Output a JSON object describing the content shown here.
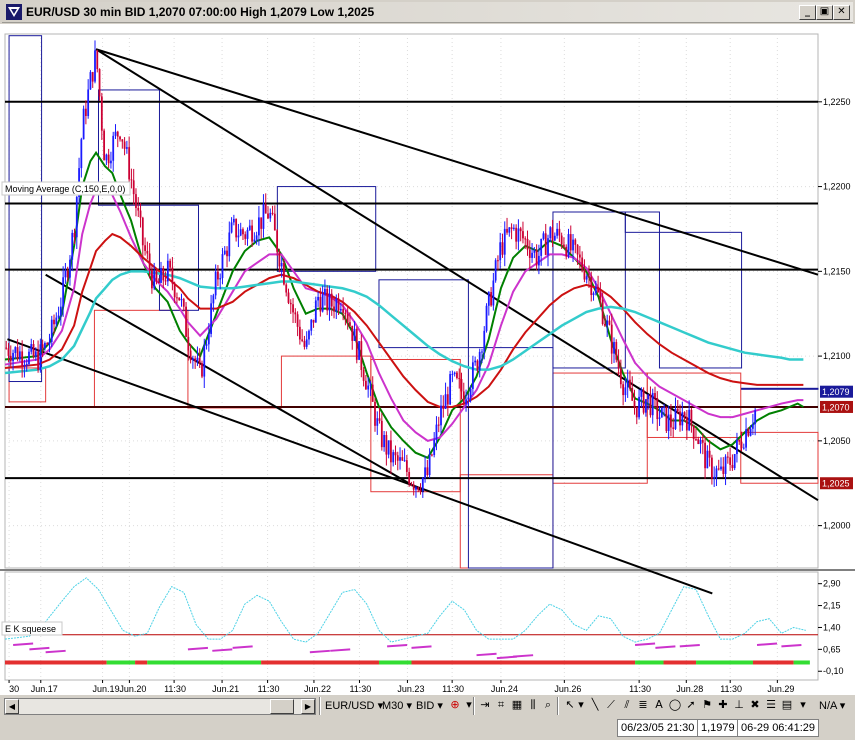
{
  "window": {
    "title": "EUR/USD 30 min BID 1,2070 07:00:00 High 1,2079 Low 1,2025",
    "min_glyph": "_",
    "max_glyph": "▣",
    "close_glyph": "✕"
  },
  "colors": {
    "candle_up": "#1a1aff",
    "candle_down": "#cc0033",
    "ma_fast": "#008000",
    "ma_mid": "#cc33cc",
    "ma_red": "#cc1111",
    "ma_cyan": "#33cccc",
    "box_blue": "#1a1a9a",
    "box_red": "#e33a3a",
    "squeeze_line": "#4dd2e6",
    "squeeze_hist": "#cc33cc",
    "squeeze_on": "#e33030",
    "squeeze_off": "#33dd33"
  },
  "chart_data": [
    {
      "type": "candlestick",
      "title": "EUR/USD 30 min BID 1,2070 07:00:00 High 1,2079 Low 1,2025",
      "indicator_label": "Moving Average (C,150,E,0,0)",
      "ylim": [
        1.1975,
        1.229
      ],
      "y_ticks": [
        {
          "value": 1.225,
          "label": "1,2250"
        },
        {
          "value": 1.22,
          "label": "1,2200"
        },
        {
          "value": 1.215,
          "label": "1,2150"
        },
        {
          "value": 1.21,
          "label": "1,2100"
        },
        {
          "value": 1.205,
          "label": "1,2050"
        },
        {
          "value": 1.2,
          "label": "1,2000"
        }
      ],
      "price_flags": [
        {
          "value": 1.2079,
          "label": "1,2079",
          "color": "#1a1a9a"
        },
        {
          "value": 1.207,
          "label": "1,2070",
          "color": "#aa1111"
        },
        {
          "value": 1.2025,
          "label": "1,2025",
          "color": "#aa1111"
        }
      ],
      "x_labels": [
        "30",
        "Jun.17",
        "Jun.19",
        "Jun.20",
        "11:30",
        "Jun.21",
        "11:30",
        "Jun.22",
        "11:30",
        "Jun.23",
        "11:30",
        "Jun.24",
        "Jun.26",
        "11:30",
        "Jun.28",
        "11:30",
        "Jun.29"
      ],
      "x_range": [
        0,
        100
      ],
      "x_label_pos": [
        0.5,
        4.4,
        12,
        15.3,
        20.8,
        26.7,
        32.3,
        38,
        43.6,
        49.5,
        55,
        61,
        68.8,
        78,
        83.8,
        89.2,
        95
      ],
      "price_path_x": [
        0,
        4,
        5.5,
        7,
        8.5,
        9.5,
        10.5,
        11.2,
        12.3,
        13.2,
        14.2,
        15.5,
        17,
        18.5,
        20,
        21.5,
        22.5,
        24,
        26,
        28,
        29.5,
        31,
        32.5,
        34,
        35.5,
        37,
        38.5,
        40,
        41.5,
        43,
        44.5,
        46,
        47.5,
        49,
        50.5,
        52,
        53.5,
        55,
        56.5,
        58,
        59.5,
        61,
        62.5,
        64,
        65.5,
        67,
        68.5,
        70,
        71.5,
        73,
        74.5,
        76,
        77.5,
        79,
        80.5,
        82,
        83.5,
        85,
        86.5,
        88,
        89.5,
        91,
        92.5,
        94,
        95.5,
        96.5,
        97.5,
        98.2
      ],
      "price_path_y": [
        1.2105,
        1.2098,
        1.211,
        1.2135,
        1.2175,
        1.2235,
        1.2262,
        1.2278,
        1.2215,
        1.2225,
        1.2235,
        1.2205,
        1.2165,
        1.214,
        1.215,
        1.2135,
        1.211,
        1.2088,
        1.2145,
        1.2175,
        1.2172,
        1.2178,
        1.2185,
        1.2155,
        1.2125,
        1.2103,
        1.2135,
        1.213,
        1.2135,
        1.211,
        1.2085,
        1.2055,
        1.204,
        1.2035,
        1.2025,
        1.203,
        1.2065,
        1.2085,
        1.2078,
        1.2095,
        1.213,
        1.2165,
        1.2175,
        1.2168,
        1.2158,
        1.2172,
        1.217,
        1.216,
        1.215,
        1.2135,
        1.211,
        1.2085,
        1.207,
        1.2075,
        1.2065,
        1.206,
        1.2067,
        1.2055,
        1.2035,
        1.203,
        1.204,
        1.2055,
        1.207
      ],
      "ma": [
        {
          "name": "fast",
          "color_key": "ma_fast",
          "y": [
            1.2098,
            1.21,
            1.2108,
            1.2125,
            1.2165,
            1.22,
            1.2215,
            1.222,
            1.2212,
            1.2208,
            1.2195,
            1.218,
            1.2155,
            1.214,
            1.2132,
            1.2115,
            1.2108,
            1.21,
            1.2125,
            1.215,
            1.2162,
            1.2168,
            1.217,
            1.216,
            1.214,
            1.2125,
            1.2128,
            1.2128,
            1.2125,
            1.2112,
            1.209,
            1.207,
            1.2058,
            1.205,
            1.2043,
            1.204,
            1.2052,
            1.2068,
            1.2075,
            1.2088,
            1.211,
            1.214,
            1.2158,
            1.2165,
            1.2162,
            1.2168,
            1.2165,
            1.2158,
            1.215,
            1.2135,
            1.211,
            1.209,
            1.2075,
            1.2072,
            1.2068,
            1.2062,
            1.2062,
            1.2058,
            1.205,
            1.2045,
            1.2048,
            1.2055,
            1.2062,
            1.2066,
            1.2068,
            1.207,
            1.2072,
            1.207
          ]
        },
        {
          "name": "mid",
          "color_key": "ma_mid",
          "y": [
            1.2095,
            1.2098,
            1.2104,
            1.2115,
            1.214,
            1.2172,
            1.219,
            1.2198,
            1.22,
            1.2195,
            1.2185,
            1.217,
            1.2155,
            1.2145,
            1.2138,
            1.2128,
            1.212,
            1.2112,
            1.2122,
            1.2138,
            1.215,
            1.2155,
            1.216,
            1.216,
            1.215,
            1.214,
            1.2138,
            1.2135,
            1.213,
            1.212,
            1.2108,
            1.209,
            1.2075,
            1.2062,
            1.2055,
            1.205,
            1.2052,
            1.206,
            1.207,
            1.208,
            1.2095,
            1.2118,
            1.2138,
            1.215,
            1.2155,
            1.216,
            1.216,
            1.2158,
            1.2152,
            1.214,
            1.2125,
            1.211,
            1.2096,
            1.2088,
            1.2082,
            1.2078,
            1.2074,
            1.207,
            1.2066,
            1.2064,
            1.2064,
            1.2066,
            1.2068,
            1.207,
            1.2072,
            1.2073,
            1.2074,
            1.2074
          ]
        },
        {
          "name": "slow",
          "color_key": "ma_red",
          "y": [
            1.2093,
            1.2095,
            1.2098,
            1.2104,
            1.2118,
            1.2138,
            1.2152,
            1.2162,
            1.2168,
            1.2172,
            1.217,
            1.2165,
            1.2158,
            1.2152,
            1.2146,
            1.214,
            1.2134,
            1.2128,
            1.2128,
            1.2132,
            1.2138,
            1.2142,
            1.2146,
            1.2148,
            1.2146,
            1.2142,
            1.2138,
            1.2136,
            1.2132,
            1.2126,
            1.2118,
            1.2108,
            1.2098,
            1.2088,
            1.208,
            1.2073,
            1.207,
            1.207,
            1.2072,
            1.2076,
            1.2082,
            1.2092,
            1.2104,
            1.2114,
            1.2122,
            1.213,
            1.2136,
            1.214,
            1.2142,
            1.214,
            1.2135,
            1.2128,
            1.212,
            1.2113,
            1.2107,
            1.2102,
            1.2098,
            1.2094,
            1.209,
            1.2087,
            1.2085,
            1.2084,
            1.2083,
            1.2083,
            1.2083,
            1.2083,
            1.2083,
            1.2083
          ]
        },
        {
          "name": "ema150",
          "color_key": "ma_cyan",
          "y": [
            1.209,
            1.2092,
            1.2094,
            1.2098,
            1.2106,
            1.2116,
            1.2126,
            1.2134,
            1.214,
            1.2145,
            1.2148,
            1.215,
            1.215,
            1.2149,
            1.2148,
            1.2146,
            1.2144,
            1.2141,
            1.214,
            1.214,
            1.2141,
            1.2142,
            1.2143,
            1.2144,
            1.2144,
            1.2143,
            1.2142,
            1.2141,
            1.214,
            1.2138,
            1.2135,
            1.213,
            1.2124,
            1.2118,
            1.2112,
            1.2106,
            1.2101,
            1.2097,
            1.2094,
            1.2092,
            1.2092,
            1.2094,
            1.2098,
            1.2103,
            1.2108,
            1.2113,
            1.2118,
            1.2122,
            1.2126,
            1.2128,
            1.2129,
            1.2128,
            1.2126,
            1.2123,
            1.212,
            1.2117,
            1.2114,
            1.2111,
            1.2108,
            1.2106,
            1.2104,
            1.2102,
            1.2101,
            1.21,
            1.2099,
            1.2098,
            1.2098,
            1.2098
          ]
        }
      ],
      "blue_boxes": [
        [
          0.5,
          4.5,
          1.2289,
          1.2085
        ],
        [
          11.5,
          19.0,
          1.2257,
          1.2189
        ],
        [
          19.0,
          23.8,
          1.2189,
          1.2127
        ],
        [
          33.5,
          45.6,
          1.22,
          1.215
        ],
        [
          46,
          57.0,
          1.2145,
          1.2105
        ],
        [
          57.0,
          67.4,
          1.2105,
          1.1975
        ],
        [
          67.4,
          76.3,
          1.2185,
          1.2093
        ],
        [
          76.3,
          80.5,
          1.2185,
          1.2173
        ],
        [
          80.5,
          90.6,
          1.2173,
          1.2093
        ],
        [
          90.6,
          100,
          1.2081,
          1.2081
        ]
      ],
      "red_boxes": [
        [
          0.5,
          5.0,
          1.2093,
          1.2073
        ],
        [
          11.0,
          22.5,
          1.2127,
          1.207
        ],
        [
          22.5,
          34.0,
          1.207,
          1.207
        ],
        [
          34.0,
          45.0,
          1.21,
          1.207
        ],
        [
          45.0,
          56.0,
          1.2098,
          1.202
        ],
        [
          56.0,
          67.4,
          1.203,
          1.1975
        ],
        [
          67.4,
          79.0,
          1.209,
          1.2025
        ],
        [
          79.0,
          90.5,
          1.209,
          1.2052
        ],
        [
          90.5,
          100,
          1.2055,
          1.2025
        ]
      ],
      "hlines": [
        1.225,
        1.219,
        1.2151,
        1.207,
        1.2028
      ],
      "trendlines": [
        [
          11.2,
          1.2281,
          100,
          1.2148
        ],
        [
          11.2,
          1.2281,
          100,
          1.2015
        ],
        [
          0.3,
          1.211,
          87,
          1.196
        ],
        [
          5.0,
          1.2148,
          51.5,
          1.202
        ]
      ],
      "legend": "none"
    },
    {
      "type": "line",
      "title": "E K squeese",
      "ylim": [
        -0.4,
        3.3
      ],
      "y_ticks": [
        {
          "value": 2.9,
          "label": "2,90"
        },
        {
          "value": 2.15,
          "label": "2,15"
        },
        {
          "value": 1.4,
          "label": "1,40"
        },
        {
          "value": 0.65,
          "label": "0,65"
        },
        {
          "value": -0.1,
          "label": "-0,10"
        }
      ],
      "threshold": 1.15,
      "squeeze_x": [
        0,
        3,
        5,
        7,
        8.5,
        10,
        11.5,
        13,
        14.5,
        16,
        17.5,
        19,
        20.5,
        22,
        23.5,
        25,
        26.5,
        28,
        29.5,
        31,
        32.5,
        34,
        35.5,
        37,
        38.5,
        40,
        41.5,
        43,
        44.5,
        46,
        47.5,
        49,
        50.5,
        52,
        53.5,
        55,
        56.5,
        58,
        59.5,
        61,
        62.5,
        64,
        65.5,
        67,
        68.5,
        70,
        71.5,
        73,
        74.5,
        76,
        77.5,
        79,
        80.5,
        82,
        83.5,
        85,
        86.5,
        88,
        89.5,
        91,
        92.5,
        94,
        95.5,
        97,
        98.5
      ],
      "squeeze_y": [
        1.0,
        1.1,
        1.6,
        2.3,
        2.8,
        3.1,
        2.7,
        2.0,
        1.3,
        1.1,
        1.2,
        2.1,
        2.8,
        2.6,
        1.5,
        1.0,
        1.0,
        1.3,
        2.2,
        2.5,
        2.3,
        1.6,
        1.0,
        0.9,
        1.2,
        1.9,
        2.6,
        2.7,
        2.2,
        1.3,
        0.9,
        1.0,
        1.1,
        1.2,
        1.8,
        2.3,
        2.0,
        1.3,
        1.0,
        1.0,
        1.0,
        1.3,
        1.8,
        2.2,
        2.0,
        1.5,
        1.3,
        1.8,
        1.7,
        1.1,
        0.9,
        1.0,
        1.2,
        2.0,
        2.8,
        2.7,
        1.8,
        1.0,
        1.0,
        1.2,
        1.6,
        1.7,
        1.2,
        1.4,
        1.3
      ],
      "hist_x": [
        1.0,
        3.0,
        5.0,
        22.5,
        25.5,
        28.0,
        37.5,
        40.0,
        47.0,
        50.0,
        58.0,
        60.5,
        62.5,
        77.5,
        80.0,
        83.0,
        92.5,
        95.5
      ],
      "hist_y": [
        0.8,
        0.65,
        0.55,
        0.65,
        0.6,
        0.7,
        0.55,
        0.6,
        0.75,
        0.7,
        0.45,
        0.35,
        0.4,
        0.8,
        0.7,
        0.75,
        0.8,
        0.75
      ],
      "status_segments": [
        [
          0,
          12.5,
          "off"
        ],
        [
          12.5,
          16,
          "on"
        ],
        [
          16,
          17.5,
          "off"
        ],
        [
          17.5,
          31.5,
          "on"
        ],
        [
          31.5,
          46,
          "off"
        ],
        [
          46,
          50,
          "on"
        ],
        [
          50,
          77.5,
          "off"
        ],
        [
          77.5,
          81,
          "on"
        ],
        [
          81,
          85,
          "off"
        ],
        [
          85,
          92,
          "on"
        ],
        [
          92,
          97,
          "off"
        ],
        [
          97,
          99,
          "on"
        ]
      ]
    }
  ],
  "statusbar": {
    "symbol": "EUR/USD",
    "timeframe": "M30",
    "side": "BID",
    "na": "N/A",
    "cursor_date": "06/23/05 21:30",
    "cursor_price": "1,1979",
    "clock": "06-29 06:41:29"
  }
}
